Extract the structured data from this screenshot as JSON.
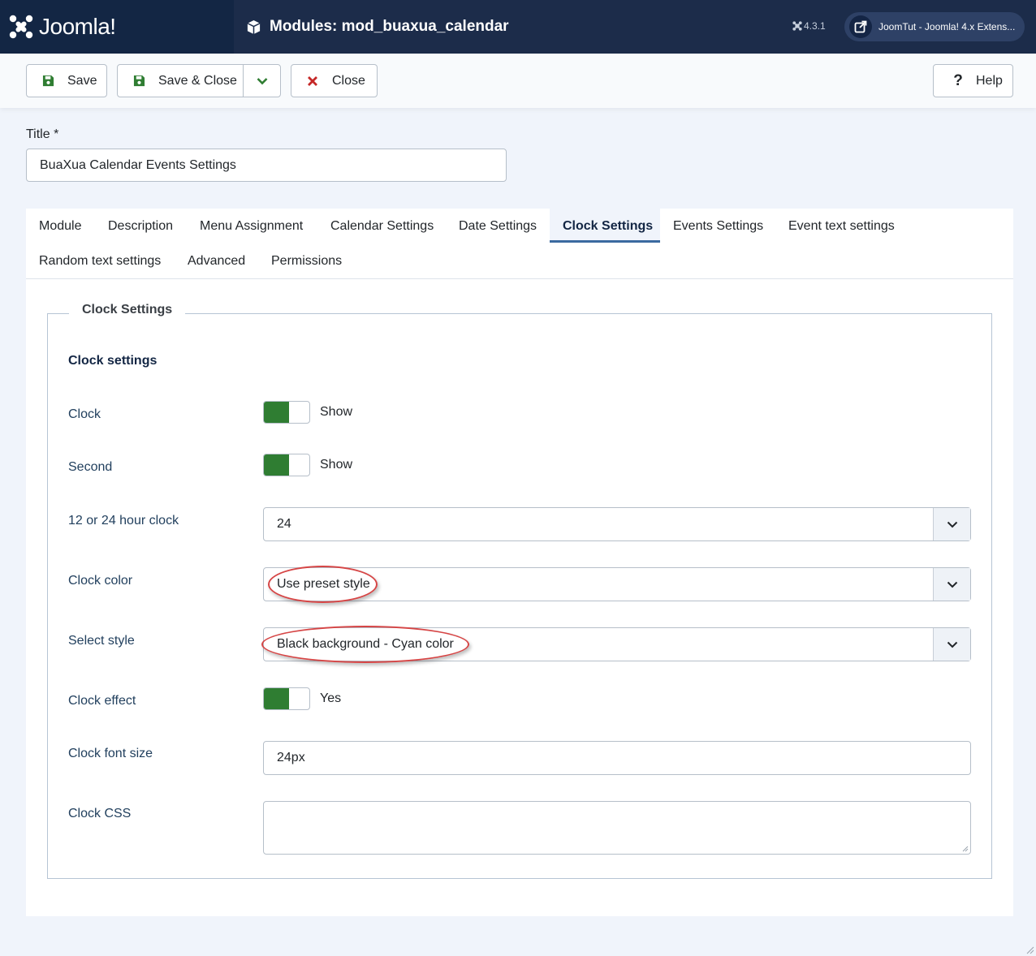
{
  "header": {
    "brand": "Joomla!",
    "page_title": "Modules: mod_buaxua_calendar",
    "version": "4.3.1",
    "site_link": "JoomTut - Joomla! 4.x Extens..."
  },
  "toolbar": {
    "save": "Save",
    "save_close": "Save & Close",
    "close": "Close",
    "help": "Help"
  },
  "title_field": {
    "label": "Title *",
    "value": "BuaXua Calendar Events Settings"
  },
  "tabs": [
    "Module",
    "Description",
    "Menu Assignment",
    "Calendar Settings",
    "Date Settings",
    "Clock Settings",
    "Events Settings",
    "Event text settings",
    "Random text settings",
    "Advanced",
    "Permissions"
  ],
  "active_tab": "Clock Settings",
  "fieldset": {
    "legend": "Clock Settings",
    "section_heading": "Clock settings",
    "fields": {
      "clock": {
        "label": "Clock",
        "state": "Show"
      },
      "second": {
        "label": "Second",
        "state": "Show"
      },
      "hour_format": {
        "label": "12 or 24 hour clock",
        "value": "24"
      },
      "clock_color": {
        "label": "Clock color",
        "value": "Use preset style"
      },
      "select_style": {
        "label": "Select style",
        "value": "Black background - Cyan color"
      },
      "clock_effect": {
        "label": "Clock effect",
        "state": "Yes"
      },
      "font_size": {
        "label": "Clock font size",
        "value": "24px"
      },
      "clock_css": {
        "label": "Clock CSS",
        "value": ""
      }
    }
  },
  "colors": {
    "header_bg": "#1c2c4a",
    "logo_bg": "#132644",
    "switch_on": "#2f7d32",
    "highlight": "#d64545",
    "active_tab_line": "#3b6aa0"
  }
}
